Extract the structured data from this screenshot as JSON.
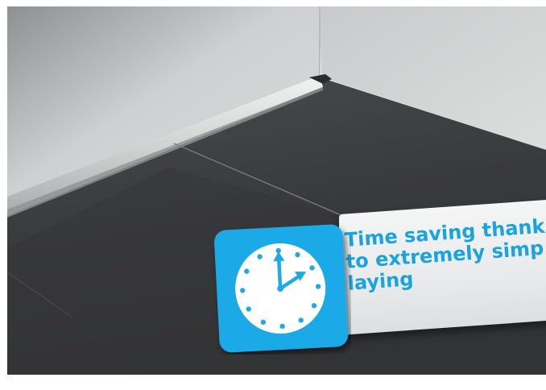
{
  "banner": {
    "lines": [
      "Time saving thank",
      "to extremely simp",
      "laying"
    ]
  },
  "colors": {
    "accent": "#19a6e4",
    "floor": "#3c3d3f",
    "wall": "#d3d4d5",
    "channel": "#d9dcdc"
  },
  "icons": {
    "badge": "clock-icon"
  }
}
